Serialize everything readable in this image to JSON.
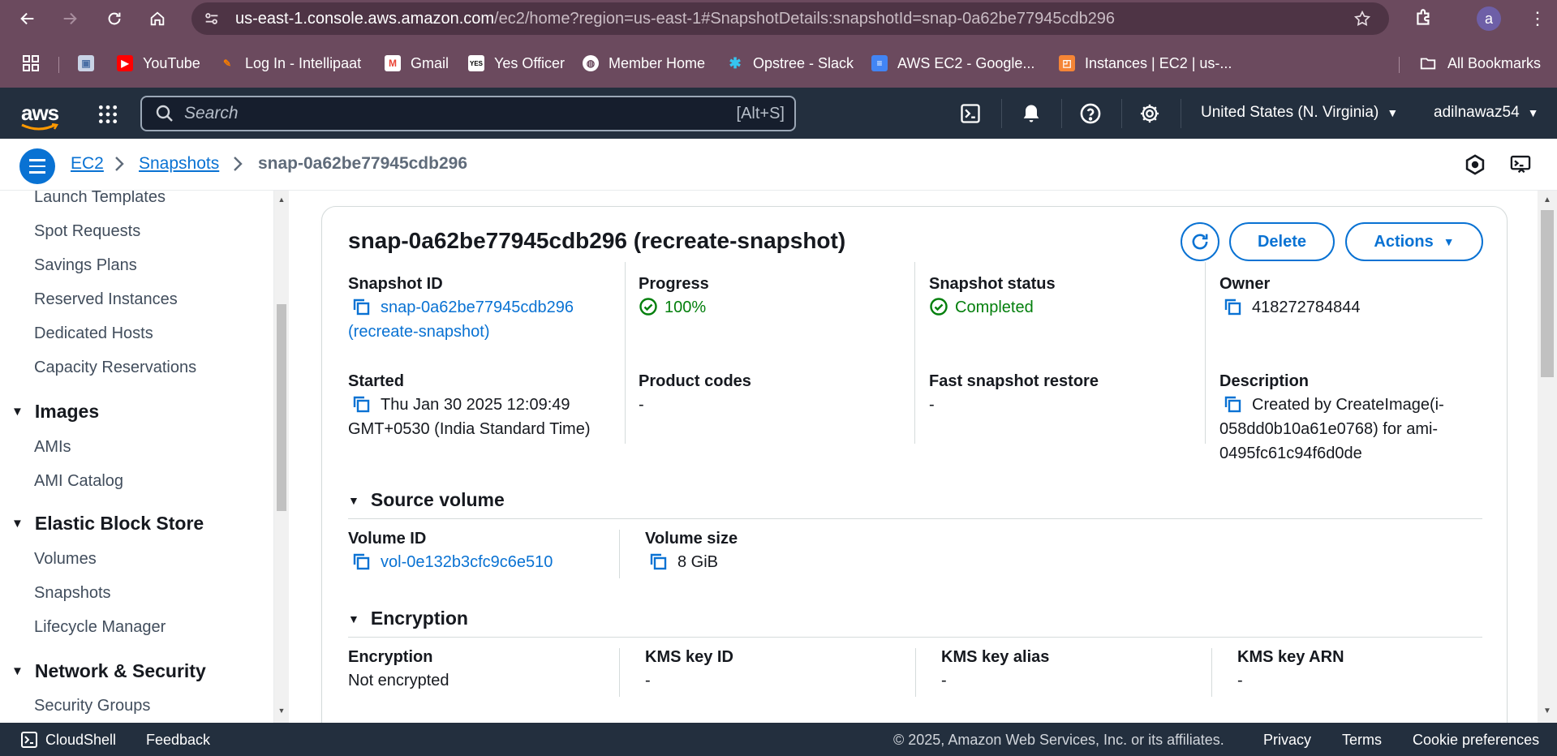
{
  "browser": {
    "url_host": "us-east-1.console.aws.amazon.com",
    "url_path": "/ec2/home?region=us-east-1#SnapshotDetails:snapshotId=snap-0a62be77945cdb296",
    "profile_initial": "a",
    "bookmarks": [
      {
        "label": "YouTube",
        "icon": "youtube-icon",
        "color": "#ff0000"
      },
      {
        "label": "Log In - Intellipaat",
        "icon": "intellipaat-icon",
        "color": "#f57c00"
      },
      {
        "label": "Gmail",
        "icon": "gmail-icon",
        "color": "#ea4335"
      },
      {
        "label": "Yes Officer",
        "icon": "yes-officer-icon",
        "color": "#ffffff"
      },
      {
        "label": "Member Home",
        "icon": "globe-icon",
        "color": "#ffffff"
      },
      {
        "label": "Opstree - Slack",
        "icon": "slack-icon",
        "color": "#e01e5a"
      },
      {
        "label": "AWS EC2 - Google...",
        "icon": "google-docs-icon",
        "color": "#4285f4"
      },
      {
        "label": "Instances | EC2 | us-...",
        "icon": "aws-ec2-icon",
        "color": "#f58536"
      }
    ],
    "all_bookmarks": "All Bookmarks"
  },
  "aws_header": {
    "logo": "aws",
    "search_placeholder": "Search",
    "search_shortcut": "[Alt+S]",
    "region": "United States (N. Virginia)",
    "user": "adilnawaz54"
  },
  "breadcrumb": {
    "items": [
      "EC2",
      "Snapshots"
    ],
    "current": "snap-0a62be77945cdb296"
  },
  "sidebar": {
    "top_items": [
      "Launch Templates",
      "Spot Requests",
      "Savings Plans",
      "Reserved Instances",
      "Dedicated Hosts",
      "Capacity Reservations"
    ],
    "sections": [
      {
        "title": "Images",
        "items": [
          "AMIs",
          "AMI Catalog"
        ]
      },
      {
        "title": "Elastic Block Store",
        "items": [
          "Volumes",
          "Snapshots",
          "Lifecycle Manager"
        ]
      },
      {
        "title": "Network & Security",
        "items": [
          "Security Groups"
        ]
      }
    ]
  },
  "snapshot": {
    "title": "snap-0a62be77945cdb296 (recreate-snapshot)",
    "buttons": {
      "delete": "Delete",
      "actions": "Actions"
    },
    "fields": {
      "snapshot_id_label": "Snapshot ID",
      "snapshot_id_line1": "snap-0a62be77945cdb296",
      "snapshot_id_line2": "(recreate-snapshot)",
      "progress_label": "Progress",
      "progress_value": "100%",
      "status_label": "Snapshot status",
      "status_value": "Completed",
      "owner_label": "Owner",
      "owner_value": "418272784844",
      "started_label": "Started",
      "started_line1": "Thu Jan 30 2025 12:09:49",
      "started_line2": "GMT+0530 (India Standard Time)",
      "product_codes_label": "Product codes",
      "product_codes_value": "-",
      "fsr_label": "Fast snapshot restore",
      "fsr_value": "-",
      "description_label": "Description",
      "description_line1": "Created by CreateImage(i-",
      "description_line2": "058dd0b10a61e0768) for ami-",
      "description_line3": "0495fc61c94f6d0de"
    },
    "source_volume": {
      "heading": "Source volume",
      "volume_id_label": "Volume ID",
      "volume_id_value": "vol-0e132b3cfc9c6e510",
      "volume_size_label": "Volume size",
      "volume_size_value": "8 GiB"
    },
    "encryption": {
      "heading": "Encryption",
      "encryption_label": "Encryption",
      "encryption_value": "Not encrypted",
      "kms_key_id_label": "KMS key ID",
      "kms_key_id_value": "-",
      "kms_key_alias_label": "KMS key alias",
      "kms_key_alias_value": "-",
      "kms_key_arn_label": "KMS key ARN",
      "kms_key_arn_value": "-"
    }
  },
  "footer": {
    "cloudshell": "CloudShell",
    "feedback": "Feedback",
    "copyright": "© 2025, Amazon Web Services, Inc. or its affiliates.",
    "privacy": "Privacy",
    "terms": "Terms",
    "cookie": "Cookie preferences"
  }
}
